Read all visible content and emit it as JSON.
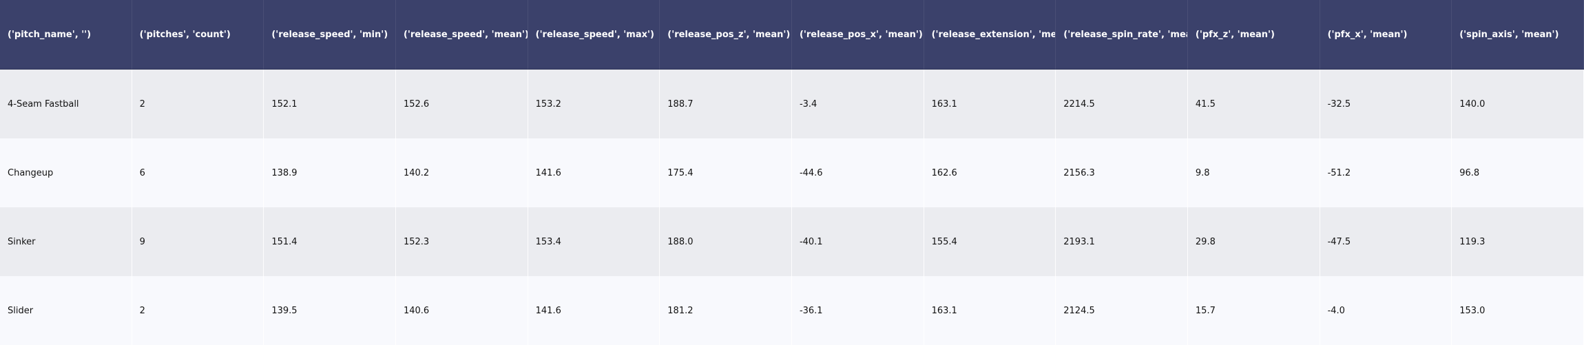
{
  "chart_data": {
    "type": "table",
    "columns": [
      "('pitch_name', '')",
      "('pitches', 'count')",
      "('release_speed', 'min')",
      "('release_speed', 'mean')",
      "('release_speed', 'max')",
      "('release_pos_z', 'mean')",
      "('release_pos_x', 'mean')",
      "('release_extension', 'mean')",
      "('release_spin_rate', 'mean')",
      "('pfx_z', 'mean')",
      "('pfx_x', 'mean')",
      "('spin_axis', 'mean')"
    ],
    "rows": [
      [
        "4-Seam Fastball",
        "2",
        "152.1",
        "152.6",
        "153.2",
        "188.7",
        "-3.4",
        "163.1",
        "2214.5",
        "41.5",
        "-32.5",
        "140.0"
      ],
      [
        "Changeup",
        "6",
        "138.9",
        "140.2",
        "141.6",
        "175.4",
        "-44.6",
        "162.6",
        "2156.3",
        "9.8",
        "-51.2",
        "96.8"
      ],
      [
        "Sinker",
        "9",
        "151.4",
        "152.3",
        "153.4",
        "188.0",
        "-40.1",
        "155.4",
        "2193.1",
        "29.8",
        "-47.5",
        "119.3"
      ],
      [
        "Slider",
        "2",
        "139.5",
        "140.6",
        "141.6",
        "181.2",
        "-36.1",
        "163.1",
        "2124.5",
        "15.7",
        "-4.0",
        "153.0"
      ]
    ]
  },
  "colors": {
    "header_bg": "#3b416b",
    "header_text": "#ffffff",
    "row_odd_bg": "#ebecf0",
    "row_even_bg": "#f8f9fd",
    "cell_text": "#111111"
  }
}
